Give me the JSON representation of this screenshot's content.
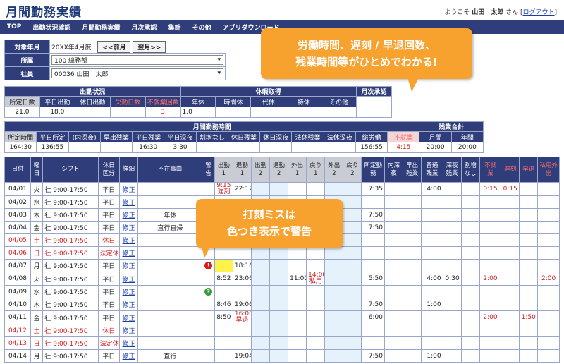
{
  "header": {
    "title": "月間勤務実績",
    "welcome_prefix": "ようこそ",
    "user_name": "山田　太郎",
    "welcome_suffix": "さん [",
    "logout": "ログアウト",
    "welcome_end": "]"
  },
  "nav": [
    "TOP",
    "出勤状況確認",
    "月間勤務実績",
    "月次承認",
    "集計",
    "その他",
    "アプリダウンロード"
  ],
  "filters": {
    "month_label": "対象年月",
    "month_value": "20XX年4月度",
    "prev": "<<前月",
    "next": "翌月>>",
    "dept_label": "所属",
    "dept_value": "100 総務部",
    "emp_label": "社員",
    "emp_value": "00036 山田　太郎"
  },
  "callout1": {
    "line1": "労働時間、遅刻 / 早退回数、",
    "line2": "残業時間等がひとめでわかる!"
  },
  "callout2": {
    "line1": "打刻ミスは",
    "line2": "色つき表示で警告"
  },
  "summary1": {
    "attendance": {
      "title": "出勤状況",
      "headers": [
        "所定日数",
        "平日出勤",
        "休日出勤",
        "欠勤日数",
        "不就業回数"
      ],
      "values": [
        "21.0",
        "18.0",
        "",
        "",
        "3"
      ]
    },
    "leave": {
      "title": "休暇取得",
      "headers": [
        "年休",
        "時間休",
        "代休",
        "特休",
        "その他"
      ],
      "values": [
        "1.0",
        "",
        "",
        "",
        ""
      ]
    },
    "approval": {
      "title": "月次承認"
    }
  },
  "summary2": {
    "title": "月間勤務時間",
    "overtime_title": "残業合計",
    "headers": [
      "所定時間",
      "平日所定",
      "(内深夜)",
      "早出残業",
      "平日残業",
      "平日深夜",
      "割増なし",
      "休日残業",
      "休日深夜",
      "法休残業",
      "法休深夜",
      "総労働",
      "不就業",
      "月間",
      "年間"
    ],
    "values": [
      "164:30",
      "136:55",
      "",
      "",
      "16:30",
      "3:30",
      "",
      "",
      "",
      "",
      "",
      "156:55",
      "4:15",
      "20:00",
      "20:00"
    ]
  },
  "daily": {
    "headers": [
      "日付",
      "曜日",
      "シフト",
      "休日区分",
      "詳細",
      "不在事由",
      "警告",
      "出勤1",
      "退勤1",
      "出勤2",
      "退勤2",
      "外出1",
      "戻り1",
      "外出2",
      "戻り2",
      "所定勤務",
      "内深夜",
      "早出残業",
      "普通残業",
      "深夜残業",
      "割増なし",
      "不就業",
      "遅刻",
      "早退",
      "私用外出"
    ],
    "rows": [
      {
        "date": "04/01",
        "dow": "火",
        "shift": "社 9:00-17:50",
        "kubun": "平日",
        "detail": "修正",
        "reason": "",
        "in1": "9:15",
        "in1b": "遅刻",
        "out1": "22:17",
        "go1": "",
        "back1": "",
        "back1b": "",
        "shotei": "7:35",
        "futsu": "4:00",
        "shinya": "",
        "fushugyo": "0:15",
        "chikoku": "0:15",
        "soutai": "",
        "shiyou": "",
        "hol": false
      },
      {
        "date": "04/02",
        "dow": "水",
        "shift": "社 9:00-17:50",
        "kubun": "平日",
        "detail": "修正",
        "reason": "",
        "in1": "",
        "in1b": "",
        "out1": "",
        "go1": "",
        "back1": "",
        "back1b": "",
        "shotei": "",
        "futsu": "",
        "shinya": "",
        "fushugyo": "",
        "chikoku": "",
        "soutai": "",
        "shiyou": "",
        "hol": false
      },
      {
        "date": "04/03",
        "dow": "木",
        "shift": "社 9:00-17:50",
        "kubun": "平日",
        "detail": "修正",
        "reason": "年休",
        "in1": "",
        "in1b": "",
        "out1": "",
        "go1": "",
        "back1": "",
        "back1b": "",
        "shotei": "7:50",
        "futsu": "",
        "shinya": "",
        "fushugyo": "",
        "chikoku": "",
        "soutai": "",
        "shiyou": "",
        "hol": false
      },
      {
        "date": "04/04",
        "dow": "金",
        "shift": "社 9:00-17:50",
        "kubun": "平日",
        "detail": "修正",
        "reason": "直行直帰",
        "in1": "",
        "in1b": "",
        "out1": "",
        "go1": "",
        "back1": "",
        "back1b": "",
        "shotei": "7:50",
        "futsu": "",
        "shinya": "",
        "fushugyo": "",
        "chikoku": "",
        "soutai": "",
        "shiyou": "",
        "hol": false
      },
      {
        "date": "04/05",
        "dow": "土",
        "shift": "社 9:00-17:50",
        "kubun": "休日",
        "detail": "修正",
        "reason": "",
        "in1": "",
        "in1b": "",
        "out1": "",
        "go1": "",
        "back1": "",
        "back1b": "",
        "shotei": "",
        "futsu": "",
        "shinya": "",
        "fushugyo": "",
        "chikoku": "",
        "soutai": "",
        "shiyou": "",
        "hol": true
      },
      {
        "date": "04/06",
        "dow": "日",
        "shift": "社 9:00-17:50",
        "kubun": "法定休",
        "detail": "修正",
        "reason": "",
        "in1": "",
        "in1b": "",
        "out1": "",
        "go1": "",
        "back1": "",
        "back1b": "",
        "shotei": "",
        "futsu": "",
        "shinya": "",
        "fushugyo": "",
        "chikoku": "",
        "soutai": "",
        "shiyou": "",
        "hol": true
      },
      {
        "date": "04/07",
        "dow": "月",
        "shift": "社 9:00-17:50",
        "kubun": "平日",
        "detail": "修正",
        "reason": "",
        "in1": "",
        "in1b": "",
        "out1": "18:16",
        "go1": "",
        "back1": "",
        "back1b": "",
        "shotei": "",
        "futsu": "",
        "shinya": "",
        "fushugyo": "",
        "chikoku": "",
        "soutai": "",
        "shiyou": "",
        "hol": false
      },
      {
        "date": "04/08",
        "dow": "火",
        "shift": "社 9:00-17:50",
        "kubun": "平日",
        "detail": "修正",
        "reason": "",
        "in1": "8:52",
        "in1b": "",
        "out1": "23:06",
        "go1": "11:00",
        "back1": "14:00",
        "back1b": "私用",
        "shotei": "5:50",
        "futsu": "4:00",
        "shinya": "0:30",
        "fushugyo": "2:00",
        "chikoku": "",
        "soutai": "",
        "shiyou": "2:00",
        "hol": false
      },
      {
        "date": "04/09",
        "dow": "水",
        "shift": "社 9:00-17:50",
        "kubun": "平日",
        "detail": "修正",
        "reason": "",
        "in1": "",
        "in1b": "",
        "out1": "",
        "go1": "",
        "back1": "",
        "back1b": "",
        "shotei": "",
        "futsu": "",
        "shinya": "",
        "fushugyo": "",
        "chikoku": "",
        "soutai": "",
        "shiyou": "",
        "hol": false
      },
      {
        "date": "04/10",
        "dow": "木",
        "shift": "社 9:00-17:50",
        "kubun": "平日",
        "detail": "修正",
        "reason": "",
        "in1": "8:46",
        "in1b": "",
        "out1": "19:06",
        "go1": "",
        "back1": "",
        "back1b": "",
        "shotei": "7:50",
        "futsu": "1:00",
        "shinya": "",
        "fushugyo": "",
        "chikoku": "",
        "soutai": "",
        "shiyou": "",
        "hol": false
      },
      {
        "date": "04/11",
        "dow": "金",
        "shift": "社 9:00-17:50",
        "kubun": "平日",
        "detail": "修正",
        "reason": "",
        "in1": "8:50",
        "in1b": "",
        "out1": "16:00",
        "out1b": "早退",
        "go1": "",
        "back1": "",
        "back1b": "",
        "shotei": "6:00",
        "futsu": "",
        "shinya": "",
        "fushugyo": "2:00",
        "chikoku": "",
        "soutai": "1:50",
        "shiyou": "",
        "hol": false
      },
      {
        "date": "04/12",
        "dow": "土",
        "shift": "社 9:00-17:50",
        "kubun": "休日",
        "detail": "修正",
        "reason": "",
        "in1": "",
        "in1b": "",
        "out1": "",
        "go1": "",
        "back1": "",
        "back1b": "",
        "shotei": "",
        "futsu": "",
        "shinya": "",
        "fushugyo": "",
        "chikoku": "",
        "soutai": "",
        "shiyou": "",
        "hol": true
      },
      {
        "date": "04/13",
        "dow": "日",
        "shift": "社 9:00-17:50",
        "kubun": "法定休",
        "detail": "修正",
        "reason": "",
        "in1": "",
        "in1b": "",
        "out1": "",
        "go1": "",
        "back1": "",
        "back1b": "",
        "shotei": "",
        "futsu": "",
        "shinya": "",
        "fushugyo": "",
        "chikoku": "",
        "soutai": "",
        "shiyou": "",
        "hol": true
      },
      {
        "date": "04/14",
        "dow": "月",
        "shift": "社 9:00-17:50",
        "kubun": "平日",
        "detail": "修正",
        "reason": "直行",
        "in1": "",
        "in1b": "",
        "out1": "19:04",
        "go1": "",
        "back1": "",
        "back1b": "",
        "shotei": "7:50",
        "futsu": "1:00",
        "shinya": "",
        "fushugyo": "",
        "chikoku": "",
        "soutai": "",
        "shiyou": "",
        "hol": false
      }
    ]
  },
  "colors": {
    "nav": "#2f3e7a",
    "accent": "#f7a12e",
    "warning_cell": "#fff24a",
    "late_text": "#d02020"
  },
  "icons": {
    "warn_row": "exclamation-icon",
    "ok_row": "question-icon"
  }
}
